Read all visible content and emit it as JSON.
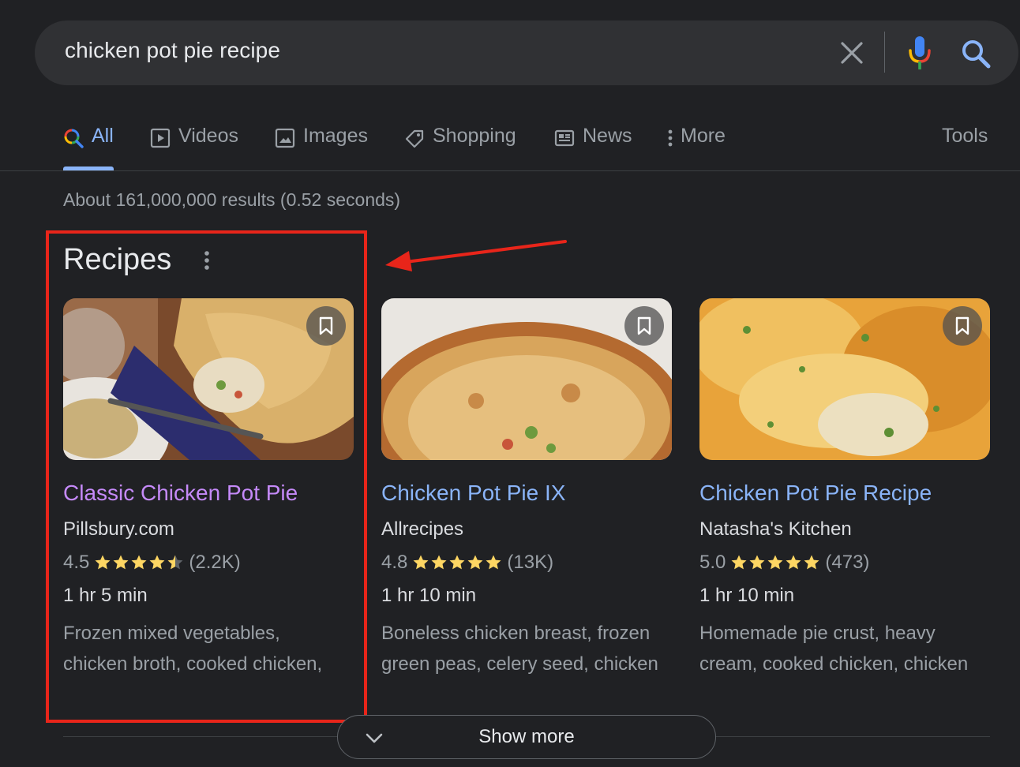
{
  "search": {
    "query": "chicken pot pie recipe"
  },
  "tabs": [
    {
      "label": "All",
      "icon": "search-icon",
      "active": true
    },
    {
      "label": "Videos",
      "icon": "play-icon"
    },
    {
      "label": "Images",
      "icon": "image-icon"
    },
    {
      "label": "Shopping",
      "icon": "tag-icon"
    },
    {
      "label": "News",
      "icon": "newspaper-icon"
    },
    {
      "label": "More",
      "icon": "more-vertical-icon"
    }
  ],
  "tools_label": "Tools",
  "result_stats": "About 161,000,000 results (0.52 seconds)",
  "recipes": {
    "title": "Recipes",
    "cards": [
      {
        "title": "Classic Chicken Pot Pie",
        "source": "Pillsbury.com",
        "rating": "4.5",
        "stars": 4.5,
        "reviews": "(2.2K)",
        "time": "1 hr 5 min",
        "ingredients_line1": "Frozen mixed vegetables,",
        "ingredients_line2": "chicken broth, cooked chicken,"
      },
      {
        "title": "Chicken Pot Pie IX",
        "source": "Allrecipes",
        "rating": "4.8",
        "stars": 5,
        "reviews": "(13K)",
        "time": "1 hr 10 min",
        "ingredients_line1": "Boneless chicken breast, frozen",
        "ingredients_line2": "green peas, celery seed, chicken"
      },
      {
        "title": "Chicken Pot Pie Recipe",
        "source": "Natasha's Kitchen",
        "rating": "5.0",
        "stars": 5,
        "reviews": "(473)",
        "time": "1 hr 10 min",
        "ingredients_line1": "Homemade pie crust, heavy",
        "ingredients_line2": "cream, cooked chicken, chicken"
      }
    ]
  },
  "show_more_label": "Show more",
  "colors": {
    "background": "#202124",
    "link": "#8ab4f8",
    "visited_link": "#c58af9",
    "star": "#fdd663",
    "annotation_red": "#e8251a"
  }
}
